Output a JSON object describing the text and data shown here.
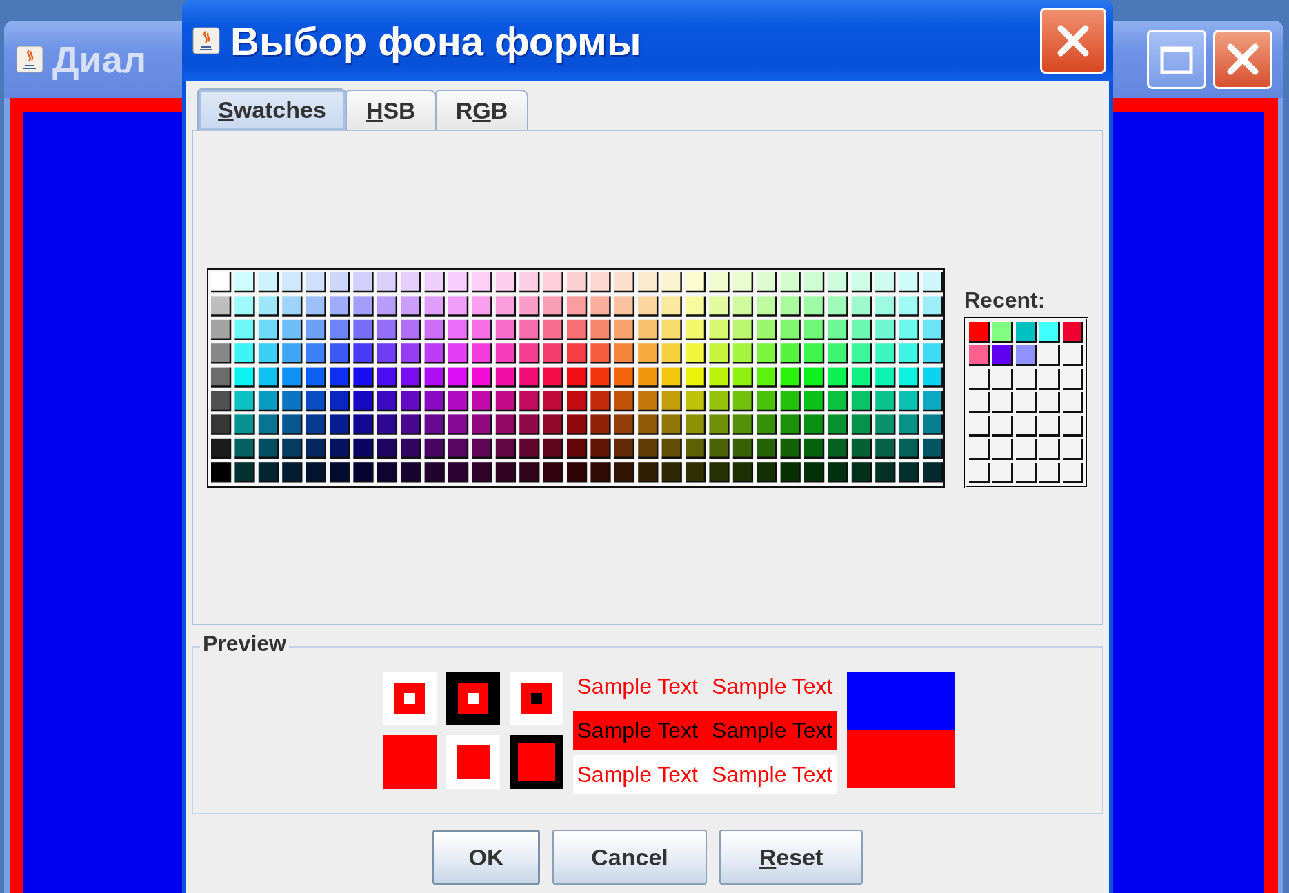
{
  "background_window": {
    "title": "Диал"
  },
  "dialog": {
    "title": "Выбор фона формы"
  },
  "tabs": [
    {
      "label_parts": [
        {
          "text": "S",
          "underlined": true
        },
        {
          "text": "watches",
          "underlined": false
        }
      ],
      "selected": true
    },
    {
      "label_parts": [
        {
          "text": "H",
          "underlined": true
        },
        {
          "text": "SB",
          "underlined": false
        }
      ],
      "selected": false
    },
    {
      "label_parts": [
        {
          "text": "R",
          "underlined": false
        },
        {
          "text": "G",
          "underlined": true
        },
        {
          "text": "B",
          "underlined": false
        }
      ],
      "selected": false
    }
  ],
  "recent": {
    "label": "Recent:",
    "swatches": [
      {
        "kind": "color",
        "color": "#ff0000"
      },
      {
        "kind": "color",
        "color": "#80ff80"
      },
      {
        "kind": "color",
        "color": "#00c0c0"
      },
      {
        "kind": "color",
        "color": "#40ffff"
      },
      {
        "kind": "color",
        "color": "#f00030"
      },
      {
        "kind": "color",
        "color": "#ff6090"
      },
      {
        "kind": "color",
        "color": "#6000f0"
      },
      {
        "kind": "color",
        "color": "#9090ff"
      },
      {
        "kind": "empty"
      },
      {
        "kind": "empty"
      },
      {
        "kind": "empty"
      },
      {
        "kind": "empty"
      },
      {
        "kind": "empty"
      },
      {
        "kind": "empty"
      },
      {
        "kind": "empty"
      },
      {
        "kind": "empty"
      },
      {
        "kind": "empty"
      },
      {
        "kind": "empty"
      },
      {
        "kind": "empty"
      },
      {
        "kind": "empty"
      },
      {
        "kind": "empty"
      },
      {
        "kind": "empty"
      },
      {
        "kind": "empty"
      },
      {
        "kind": "empty"
      },
      {
        "kind": "empty"
      },
      {
        "kind": "empty"
      },
      {
        "kind": "empty"
      },
      {
        "kind": "empty"
      },
      {
        "kind": "empty"
      },
      {
        "kind": "empty"
      },
      {
        "kind": "empty"
      },
      {
        "kind": "empty"
      },
      {
        "kind": "empty"
      },
      {
        "kind": "empty"
      },
      {
        "kind": "empty"
      }
    ]
  },
  "preview": {
    "label": "Preview",
    "comparison": [
      {
        "kind": "original",
        "color": "#0000ff"
      },
      {
        "kind": "selected",
        "color": "#ff0000"
      }
    ],
    "sample_rows": [
      {
        "kind": "plain",
        "texts": [
          "Sample Text",
          "Sample Text"
        ]
      },
      {
        "kind": "filled",
        "texts": [
          "Sample Text",
          "Sample Text"
        ]
      },
      {
        "kind": "white",
        "texts": [
          "Sample Text",
          "Sample Text"
        ]
      }
    ]
  },
  "buttons": [
    {
      "label_parts": [
        {
          "text": "OK",
          "underlined": false
        }
      ],
      "default": true
    },
    {
      "label_parts": [
        {
          "text": "Cancel",
          "underlined": false
        }
      ],
      "default": false
    },
    {
      "label_parts": [
        {
          "text": "R",
          "underlined": true
        },
        {
          "text": "eset",
          "underlined": false
        }
      ],
      "default": false
    }
  ]
}
